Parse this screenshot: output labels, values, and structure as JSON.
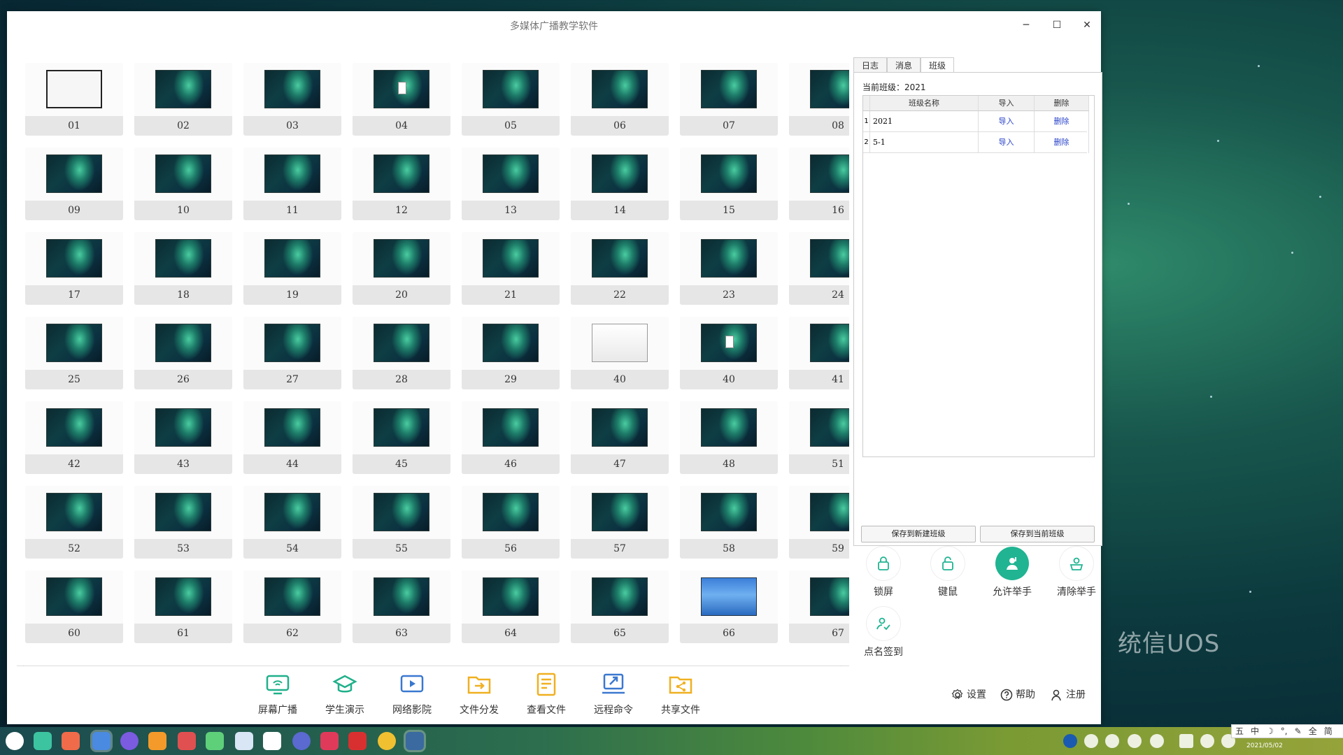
{
  "window": {
    "title": "多媒体广播教学软件",
    "controls": {
      "minimize": "─",
      "maximize": "☐",
      "close": "✕"
    }
  },
  "students": [
    {
      "label": "01",
      "thumb": "screen"
    },
    {
      "label": "02",
      "thumb": "aurora"
    },
    {
      "label": "03",
      "thumb": "aurora"
    },
    {
      "label": "04",
      "thumb": "aurora-window"
    },
    {
      "label": "05",
      "thumb": "aurora"
    },
    {
      "label": "06",
      "thumb": "aurora"
    },
    {
      "label": "07",
      "thumb": "aurora"
    },
    {
      "label": "08",
      "thumb": "aurora"
    },
    {
      "label": "09",
      "thumb": "aurora"
    },
    {
      "label": "10",
      "thumb": "aurora"
    },
    {
      "label": "11",
      "thumb": "aurora"
    },
    {
      "label": "12",
      "thumb": "aurora"
    },
    {
      "label": "13",
      "thumb": "aurora"
    },
    {
      "label": "14",
      "thumb": "aurora"
    },
    {
      "label": "15",
      "thumb": "aurora"
    },
    {
      "label": "16",
      "thumb": "aurora"
    },
    {
      "label": "17",
      "thumb": "aurora"
    },
    {
      "label": "18",
      "thumb": "aurora"
    },
    {
      "label": "19",
      "thumb": "aurora"
    },
    {
      "label": "20",
      "thumb": "aurora"
    },
    {
      "label": "21",
      "thumb": "aurora"
    },
    {
      "label": "22",
      "thumb": "aurora"
    },
    {
      "label": "23",
      "thumb": "aurora"
    },
    {
      "label": "24",
      "thumb": "aurora"
    },
    {
      "label": "25",
      "thumb": "aurora"
    },
    {
      "label": "26",
      "thumb": "aurora"
    },
    {
      "label": "27",
      "thumb": "aurora"
    },
    {
      "label": "28",
      "thumb": "aurora"
    },
    {
      "label": "29",
      "thumb": "aurora"
    },
    {
      "label": "40",
      "thumb": "white-window"
    },
    {
      "label": "40",
      "thumb": "aurora-window"
    },
    {
      "label": "41",
      "thumb": "aurora"
    },
    {
      "label": "42",
      "thumb": "aurora"
    },
    {
      "label": "43",
      "thumb": "aurora"
    },
    {
      "label": "44",
      "thumb": "aurora"
    },
    {
      "label": "45",
      "thumb": "aurora"
    },
    {
      "label": "46",
      "thumb": "aurora"
    },
    {
      "label": "47",
      "thumb": "aurora"
    },
    {
      "label": "48",
      "thumb": "aurora"
    },
    {
      "label": "51",
      "thumb": "aurora"
    },
    {
      "label": "52",
      "thumb": "aurora"
    },
    {
      "label": "53",
      "thumb": "aurora"
    },
    {
      "label": "54",
      "thumb": "aurora"
    },
    {
      "label": "55",
      "thumb": "aurora"
    },
    {
      "label": "56",
      "thumb": "aurora"
    },
    {
      "label": "57",
      "thumb": "aurora"
    },
    {
      "label": "58",
      "thumb": "aurora"
    },
    {
      "label": "59",
      "thumb": "aurora"
    },
    {
      "label": "60",
      "thumb": "aurora"
    },
    {
      "label": "61",
      "thumb": "aurora"
    },
    {
      "label": "62",
      "thumb": "aurora"
    },
    {
      "label": "63",
      "thumb": "aurora"
    },
    {
      "label": "64",
      "thumb": "aurora"
    },
    {
      "label": "65",
      "thumb": "aurora"
    },
    {
      "label": "66",
      "thumb": "fish"
    },
    {
      "label": "67",
      "thumb": "aurora"
    }
  ],
  "tabs": [
    {
      "label": "日志",
      "active": false
    },
    {
      "label": "消息",
      "active": false
    },
    {
      "label": "班级",
      "active": true
    }
  ],
  "class_panel": {
    "current_label": "当前班级：",
    "current_value": "2021",
    "headers": [
      "班级名称",
      "导入",
      "删除"
    ],
    "rows": [
      {
        "index": "1",
        "name": "2021",
        "import": "导入",
        "delete": "删除"
      },
      {
        "index": "2",
        "name": "5-1",
        "import": "导入",
        "delete": "删除"
      }
    ],
    "save_new": "保存到新建班级",
    "save_current": "保存到当前班级"
  },
  "actions": [
    {
      "label": "锁屏",
      "icon": "lock-icon",
      "active": false
    },
    {
      "label": "键鼠",
      "icon": "keyboard-mouse-lock-icon",
      "active": false
    },
    {
      "label": "允许举手",
      "icon": "raise-hand-icon",
      "active": true
    },
    {
      "label": "清除举手",
      "icon": "clear-hand-icon",
      "active": false
    },
    {
      "label": "点名签到",
      "icon": "roll-call-icon",
      "active": false
    }
  ],
  "toolbar": [
    {
      "label": "屏幕广播",
      "icon": "screen-broadcast-icon",
      "color": "#1fb08a"
    },
    {
      "label": "学生演示",
      "icon": "student-demo-icon",
      "color": "#1fb08a"
    },
    {
      "label": "网络影院",
      "icon": "network-cinema-icon",
      "color": "#3a78d0"
    },
    {
      "label": "文件分发",
      "icon": "file-distribute-icon",
      "color": "#f0b020"
    },
    {
      "label": "查看文件",
      "icon": "view-file-icon",
      "color": "#f0b020"
    },
    {
      "label": "远程命令",
      "icon": "remote-command-icon",
      "color": "#3a78d0"
    },
    {
      "label": "共享文件",
      "icon": "share-file-icon",
      "color": "#f0b020"
    }
  ],
  "utility": {
    "settings": "设置",
    "help": "帮助",
    "register": "注册"
  },
  "desktop": {
    "brand": "统信UOS",
    "date": "2021/05/02"
  },
  "ime": [
    "五",
    "中",
    "☽",
    "°,",
    "✎",
    "全",
    "简"
  ],
  "colors": {
    "accent": "#20b492",
    "link": "#2a44c8"
  }
}
